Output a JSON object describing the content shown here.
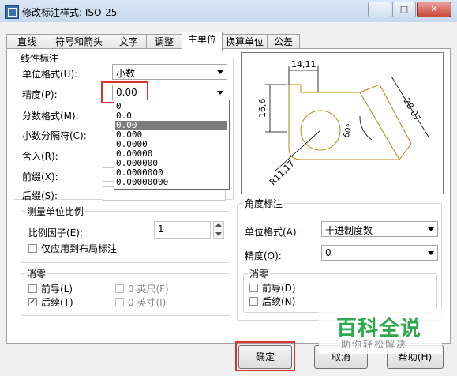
{
  "window": {
    "title": "修改标注样式: ISO-25",
    "min_label": "−",
    "max_label": "□",
    "close_label": "✕"
  },
  "tabs": [
    {
      "label": "直线"
    },
    {
      "label": "符号和箭头"
    },
    {
      "label": "文字"
    },
    {
      "label": "调整"
    },
    {
      "label": "主单位"
    },
    {
      "label": "换算单位"
    },
    {
      "label": "公差"
    }
  ],
  "linear": {
    "group_title": "线性标注",
    "unit_format_label": "单位格式(U):",
    "unit_format_value": "小数",
    "precision_label": "精度(P):",
    "precision_value": "0.00",
    "fraction_label": "分数格式(M):",
    "decimal_sep_label": "小数分隔符(C):",
    "roundoff_label": "舍入(R):",
    "prefix_label": "前缀(X):",
    "suffix_label": "后缀(S):"
  },
  "precision_options": [
    "0",
    "0.0",
    "0.00",
    "0.000",
    "0.0000",
    "0.00000",
    "0.000000",
    "0.0000000",
    "0.00000000"
  ],
  "precision_selected": "0.00",
  "scale": {
    "group_title": "测量单位比例",
    "factor_label": "比例因子(E):",
    "factor_value": "1",
    "layout_only_label": "仅应用到布局标注"
  },
  "zero_suppress": {
    "group_title": "消零",
    "leading_label": "前导(L)",
    "trailing_label": "后续(T)",
    "feet_label": "0 英尺(F)",
    "inches_label": "0 英寸(I)",
    "leading_checked": false,
    "trailing_checked": true
  },
  "preview": {
    "dim_top": "14,11",
    "dim_left": "16,6",
    "dim_right": "28,07",
    "dim_angle": "60°",
    "dim_radius": "R11,17"
  },
  "angular": {
    "group_title": "角度标注",
    "unit_format_label": "单位格式(A):",
    "unit_format_value": "十进制度数",
    "precision_label": "精度(O):",
    "precision_value": "0",
    "zero_group_title": "消零",
    "leading_label": "前导(D)",
    "trailing_label": "后续(N)"
  },
  "buttons": {
    "ok": "确定",
    "cancel": "取消",
    "help": "帮助(H)"
  },
  "watermark": {
    "main": "百科全说",
    "sub": "助你轻松解决"
  }
}
